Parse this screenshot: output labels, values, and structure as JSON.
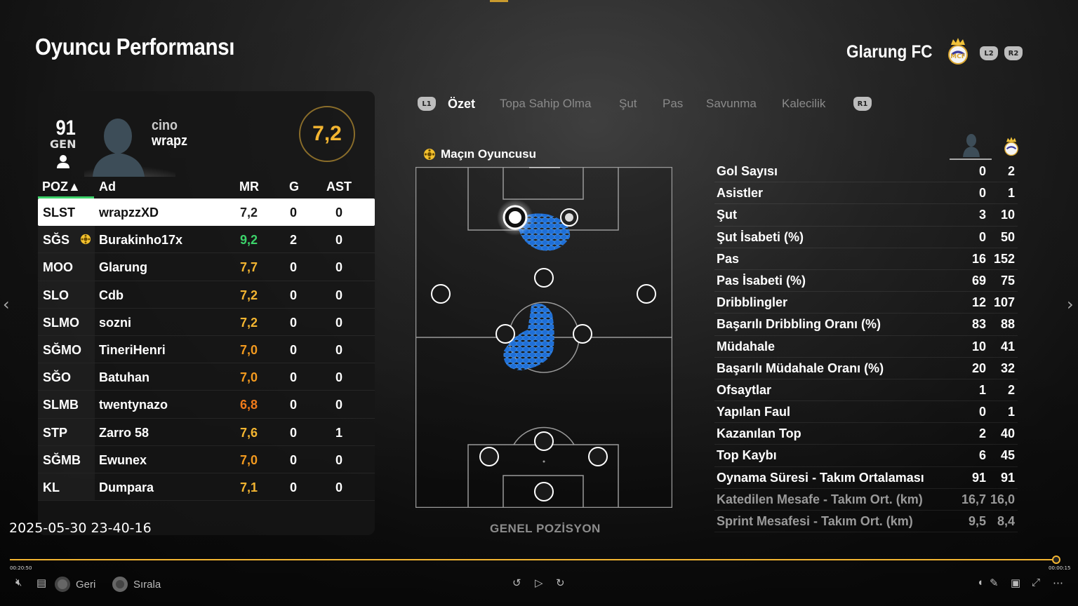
{
  "page_title": "Oyuncu Performansı",
  "team_name": "Glarung FC",
  "shoulder_buttons": {
    "l2": "L2",
    "r2": "R2",
    "l1": "L1",
    "r1": "R1"
  },
  "player_card": {
    "overall": "91",
    "overall_label": "GEN",
    "first_name": "cino",
    "last_name": "wrapz",
    "match_rating": "7,2"
  },
  "table": {
    "headers": {
      "pos": "POZ▲",
      "name": "Ad",
      "mr": "MR",
      "g": "G",
      "ast": "AST"
    },
    "rows": [
      {
        "pos": "SLST",
        "name": "wrapzzXD",
        "mr": "7,2",
        "mr_color": "#222222",
        "g": "0",
        "ast": "0",
        "selected": true
      },
      {
        "pos": "SĞS",
        "name": "Burakinho17x",
        "mr": "9,2",
        "mr_color": "#3cd26a",
        "g": "2",
        "ast": "0",
        "potm": true
      },
      {
        "pos": "MOO",
        "name": "Glarung",
        "mr": "7,7",
        "mr_color": "#f3b531",
        "g": "0",
        "ast": "0"
      },
      {
        "pos": "SLO",
        "name": "Cdb",
        "mr": "7,2",
        "mr_color": "#f3b531",
        "g": "0",
        "ast": "0"
      },
      {
        "pos": "SLMO",
        "name": "sozni",
        "mr": "7,2",
        "mr_color": "#f3b531",
        "g": "0",
        "ast": "0"
      },
      {
        "pos": "SĞMO",
        "name": "TineriHenri",
        "mr": "7,0",
        "mr_color": "#f39a1f",
        "g": "0",
        "ast": "0"
      },
      {
        "pos": "SĞO",
        "name": "Batuhan",
        "mr": "7,0",
        "mr_color": "#f39a1f",
        "g": "0",
        "ast": "0"
      },
      {
        "pos": "SLMB",
        "name": "twentynazo",
        "mr": "6,8",
        "mr_color": "#f07a1a",
        "g": "0",
        "ast": "0"
      },
      {
        "pos": "STP",
        "name": "Zarro 58",
        "mr": "7,6",
        "mr_color": "#f3b531",
        "g": "0",
        "ast": "1"
      },
      {
        "pos": "SĞMB",
        "name": "Ewunex",
        "mr": "7,0",
        "mr_color": "#f39a1f",
        "g": "0",
        "ast": "0"
      },
      {
        "pos": "KL",
        "name": "Dumpara",
        "mr": "7,1",
        "mr_color": "#f3b531",
        "g": "0",
        "ast": "0"
      }
    ]
  },
  "tabs": [
    "Özet",
    "Topa Sahip Olma",
    "Şut",
    "Pas",
    "Savunma",
    "Kalecilik"
  ],
  "active_tab": "Özet",
  "potm_label": "Maçın Oyuncusu",
  "pitch_label": "GENEL POZİSYON",
  "stats": [
    {
      "label": "Gol Sayısı",
      "player": "0",
      "team": "2"
    },
    {
      "label": "Asistler",
      "player": "0",
      "team": "1"
    },
    {
      "label": "Şut",
      "player": "3",
      "team": "10"
    },
    {
      "label": "Şut İsabeti (%)",
      "player": "0",
      "team": "50"
    },
    {
      "label": "Pas",
      "player": "16",
      "team": "152"
    },
    {
      "label": "Pas İsabeti (%)",
      "player": "69",
      "team": "75"
    },
    {
      "label": "Dribblingler",
      "player": "12",
      "team": "107"
    },
    {
      "label": "Başarılı Dribbling Oranı (%)",
      "player": "83",
      "team": "88"
    },
    {
      "label": "Müdahale",
      "player": "10",
      "team": "41"
    },
    {
      "label": "Başarılı Müdahale Oranı (%)",
      "player": "20",
      "team": "32"
    },
    {
      "label": "Ofsaytlar",
      "player": "1",
      "team": "2"
    },
    {
      "label": "Yapılan Faul",
      "player": "0",
      "team": "1"
    },
    {
      "label": "Kazanılan Top",
      "player": "2",
      "team": "40"
    },
    {
      "label": "Top Kaybı",
      "player": "6",
      "team": "45"
    },
    {
      "label": "Oynama Süresi - Takım Ortalaması",
      "player": "91",
      "team": "91"
    },
    {
      "label": "Katedilen Mesafe - Takım Ort. (km)",
      "player": "16,7",
      "team": "16,0",
      "dim": true
    },
    {
      "label": "Sprint Mesafesi - Takım Ort. (km)",
      "player": "9,5",
      "team": "8,4",
      "dim": true
    }
  ],
  "timestamp": "2025-05-30 23-40-16",
  "video": {
    "time_left": "00:20:50",
    "time_right": "00:00:15",
    "progress": 0.996
  },
  "controls": {
    "back": "Geri",
    "sort": "Sırala"
  },
  "icons": {
    "potm": "star-ball-icon",
    "crest": "crest-icon",
    "player": "player-silhouette-icon"
  }
}
